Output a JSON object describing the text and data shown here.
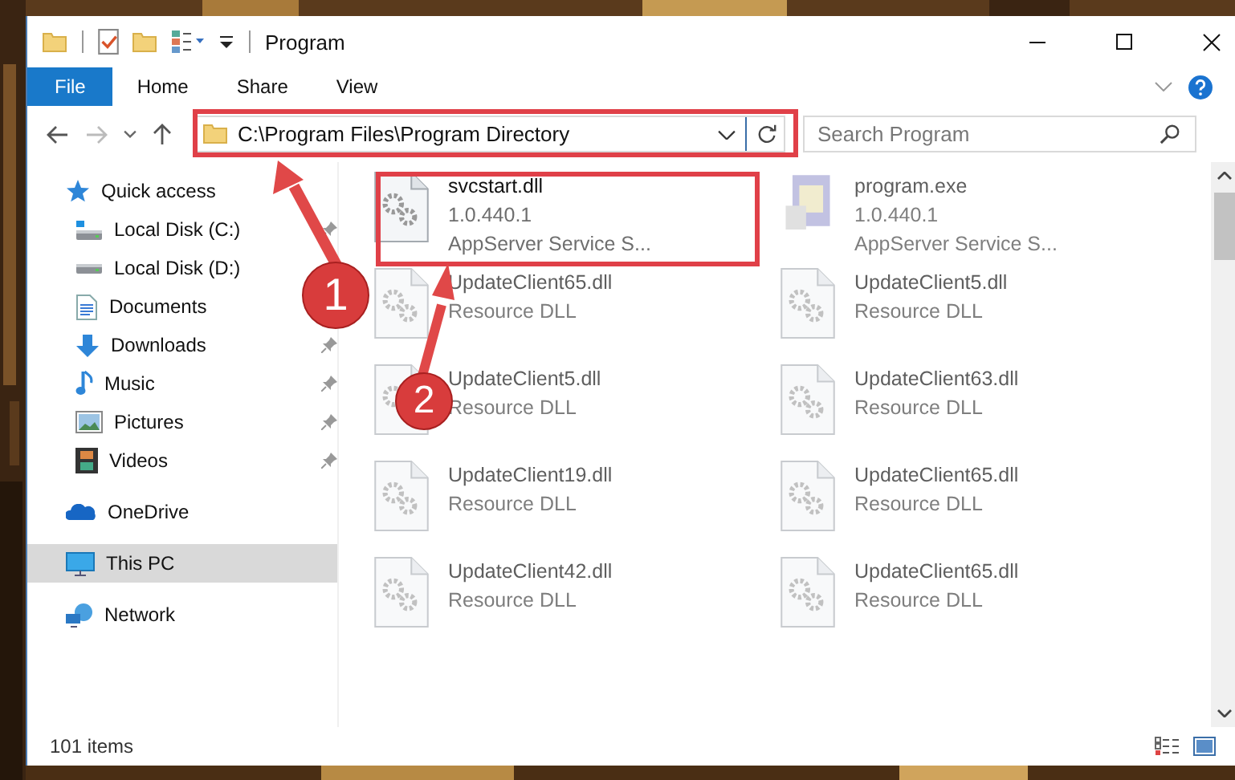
{
  "window": {
    "title": "Program"
  },
  "ribbon_tabs": [
    {
      "label": "File",
      "selected": true
    },
    {
      "label": "Home",
      "selected": false
    },
    {
      "label": "Share",
      "selected": false
    },
    {
      "label": "View",
      "selected": false
    }
  ],
  "address": {
    "path": "C:\\Program Files\\Program Directory"
  },
  "search": {
    "placeholder": "Search Program"
  },
  "sidebar": {
    "items": [
      {
        "label": "Quick access",
        "kind": "star",
        "selected": false,
        "children": [
          {
            "label": "Local Disk (C:)",
            "kind": "drive-c",
            "pinned": true,
            "selected": false
          },
          {
            "label": "Local Disk (D:)",
            "kind": "drive",
            "selected": false
          },
          {
            "label": "Documents",
            "kind": "documents",
            "selected": false
          },
          {
            "label": "Downloads",
            "kind": "downloads",
            "pinned": true,
            "selected": false
          },
          {
            "label": "Music",
            "kind": "music",
            "pinned": true,
            "selected": false
          },
          {
            "label": "Pictures",
            "kind": "pictures",
            "pinned": true,
            "selected": false
          },
          {
            "label": "Videos",
            "kind": "videos",
            "pinned": true,
            "selected": false
          }
        ]
      },
      {
        "label": "OneDrive",
        "kind": "cloud",
        "selected": false
      },
      {
        "label": "This PC",
        "kind": "pc",
        "selected": true
      },
      {
        "label": "Network",
        "kind": "network",
        "selected": false
      }
    ]
  },
  "files": [
    {
      "name": "svcstart.dll",
      "lines": [
        "1.0.440.1",
        "AppServer Service S..."
      ],
      "kind": "dll",
      "blurred": false
    },
    {
      "name": "program.exe",
      "lines": [
        "1.0.440.1",
        "AppServer Service S..."
      ],
      "kind": "exe",
      "blurred": true
    },
    {
      "name": "UpdateClient65.dll",
      "lines": [
        "Resource DLL"
      ],
      "kind": "dll",
      "blurred": true
    },
    {
      "name": "UpdateClient5.dll",
      "lines": [
        "Resource DLL"
      ],
      "kind": "dll",
      "blurred": true
    },
    {
      "name": "UpdateClient5.dll",
      "lines": [
        "Resource DLL"
      ],
      "kind": "dll",
      "blurred": true
    },
    {
      "name": "UpdateClient63.dll",
      "lines": [
        "Resource DLL"
      ],
      "kind": "dll",
      "blurred": true
    },
    {
      "name": "UpdateClient19.dll",
      "lines": [
        "Resource DLL"
      ],
      "kind": "dll",
      "blurred": true
    },
    {
      "name": "UpdateClient65.dll",
      "lines": [
        "Resource DLL"
      ],
      "kind": "dll",
      "blurred": true
    },
    {
      "name": "UpdateClient42.dll",
      "lines": [
        "Resource DLL"
      ],
      "kind": "dll",
      "blurred": true
    },
    {
      "name": "UpdateClient65.dll",
      "lines": [
        "Resource DLL"
      ],
      "kind": "dll",
      "blurred": true
    }
  ],
  "status_bar": {
    "count": "101 items"
  },
  "callouts": [
    {
      "number": "1"
    },
    {
      "number": "2"
    }
  ]
}
